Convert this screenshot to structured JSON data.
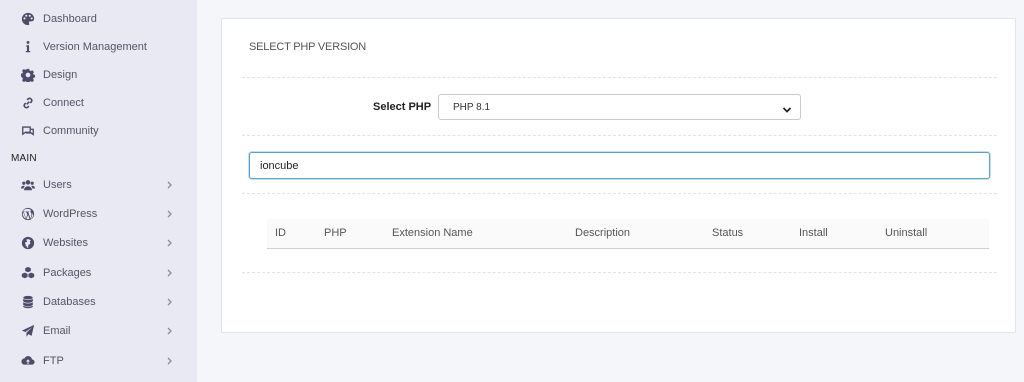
{
  "sidebar": {
    "top_items": [
      {
        "label": "Dashboard",
        "icon": "palette-icon"
      },
      {
        "label": "Version Management",
        "icon": "info-icon"
      },
      {
        "label": "Design",
        "icon": "gear-icon"
      },
      {
        "label": "Connect",
        "icon": "link-icon"
      },
      {
        "label": "Community",
        "icon": "comments-icon"
      }
    ],
    "section_label": "MAIN",
    "main_items": [
      {
        "label": "Users",
        "icon": "users-icon"
      },
      {
        "label": "WordPress",
        "icon": "wordpress-icon"
      },
      {
        "label": "Websites",
        "icon": "globe-icon"
      },
      {
        "label": "Packages",
        "icon": "cubes-icon"
      },
      {
        "label": "Databases",
        "icon": "database-icon"
      },
      {
        "label": "Email",
        "icon": "paper-plane-icon"
      },
      {
        "label": "FTP",
        "icon": "cloud-upload-icon"
      }
    ]
  },
  "panel": {
    "title": "SELECT PHP VERSION",
    "select_label": "Select PHP",
    "selected_php": "PHP 8.1",
    "search_value": "ioncube"
  },
  "table": {
    "columns": [
      "ID",
      "PHP",
      "Extension Name",
      "Description",
      "Status",
      "Install",
      "Uninstall"
    ],
    "rows": []
  },
  "colors": {
    "sidebar_bg": "#e8e9f3",
    "accent_icon": "#4e4b68",
    "focus_border": "#5aa3c8"
  }
}
